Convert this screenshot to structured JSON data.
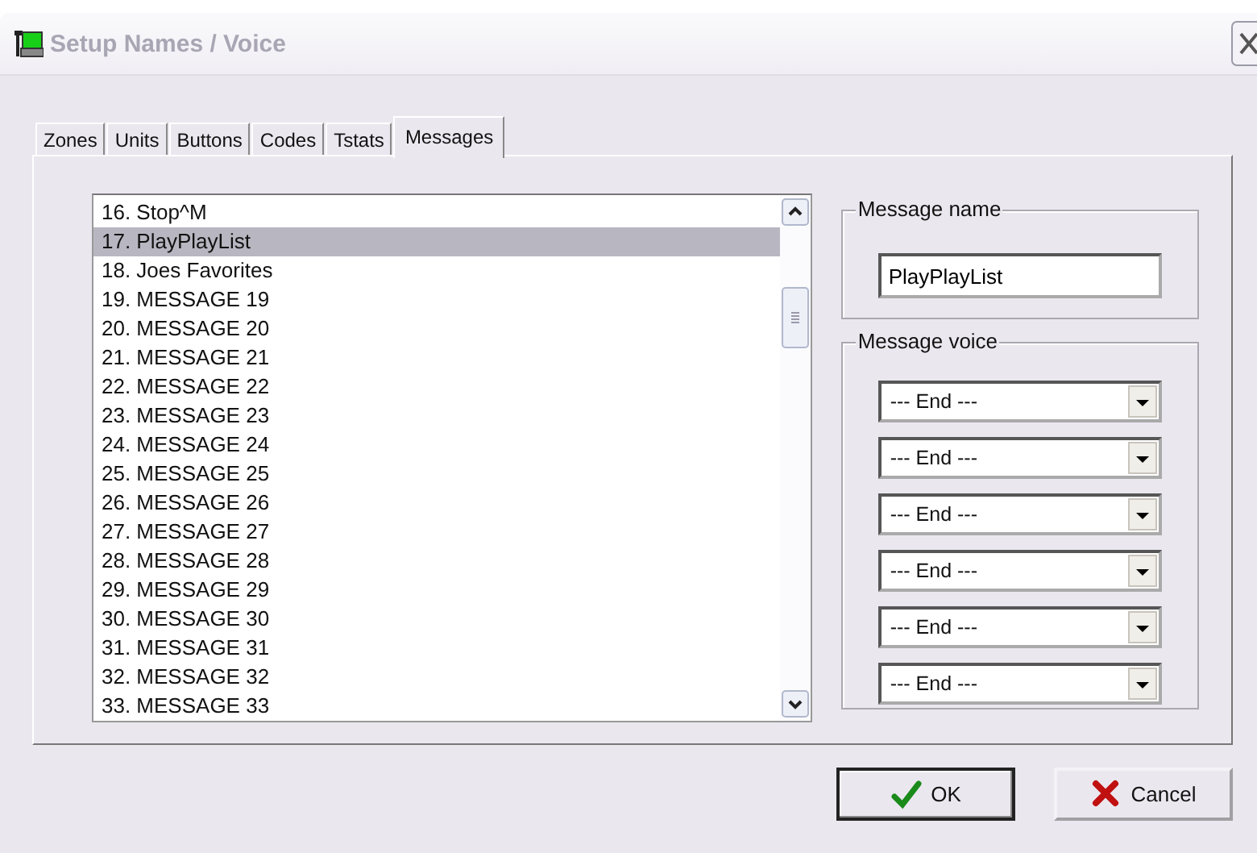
{
  "window": {
    "title": "Setup Names / Voice"
  },
  "tabs": [
    {
      "label": "Zones",
      "selected": false
    },
    {
      "label": "Units",
      "selected": false
    },
    {
      "label": "Buttons",
      "selected": false
    },
    {
      "label": "Codes",
      "selected": false
    },
    {
      "label": "Tstats",
      "selected": false
    },
    {
      "label": "Messages",
      "selected": true
    }
  ],
  "message_list": {
    "items": [
      {
        "label": "16. Stop^M",
        "selected": false
      },
      {
        "label": "17. PlayPlayList",
        "selected": true
      },
      {
        "label": "18. Joes Favorites",
        "selected": false
      },
      {
        "label": "19. MESSAGE 19",
        "selected": false
      },
      {
        "label": "20. MESSAGE 20",
        "selected": false
      },
      {
        "label": "21. MESSAGE 21",
        "selected": false
      },
      {
        "label": "22. MESSAGE 22",
        "selected": false
      },
      {
        "label": "23. MESSAGE 23",
        "selected": false
      },
      {
        "label": "24. MESSAGE 24",
        "selected": false
      },
      {
        "label": "25. MESSAGE 25",
        "selected": false
      },
      {
        "label": "26. MESSAGE 26",
        "selected": false
      },
      {
        "label": "27. MESSAGE 27",
        "selected": false
      },
      {
        "label": "28. MESSAGE 28",
        "selected": false
      },
      {
        "label": "29. MESSAGE 29",
        "selected": false
      },
      {
        "label": "30. MESSAGE 30",
        "selected": false
      },
      {
        "label": "31. MESSAGE 31",
        "selected": false
      },
      {
        "label": "32. MESSAGE 32",
        "selected": false
      },
      {
        "label": "33. MESSAGE 33",
        "selected": false
      }
    ]
  },
  "message_name": {
    "title": "Message name",
    "value": "PlayPlayList"
  },
  "message_voice": {
    "title": "Message voice",
    "dropdowns": [
      "--- End ---",
      "--- End ---",
      "--- End ---",
      "--- End ---",
      "--- End ---",
      "--- End ---"
    ]
  },
  "buttons": [
    {
      "kind": "ok",
      "label": "OK",
      "default": true
    },
    {
      "kind": "cancel",
      "label": "Cancel",
      "default": false
    }
  ]
}
